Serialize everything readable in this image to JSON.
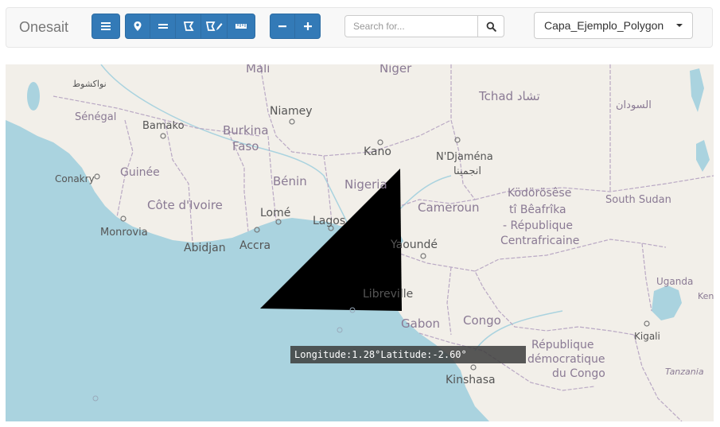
{
  "navbar": {
    "brand": "Onesait",
    "search": {
      "placeholder": "Search for...",
      "value": ""
    },
    "layer_select": {
      "selected": "Capa_Ejemplo_Polygon"
    }
  },
  "toolbar_icons": [
    "menu-icon",
    "map-marker-icon",
    "line-icon",
    "polygon-icon",
    "polygon-edit-icon",
    "ruler-icon",
    "zoom-out-icon",
    "zoom-in-icon",
    "search-icon"
  ],
  "colors": {
    "primary": "#337ab7",
    "ocean": "#aad3df",
    "land": "#f2efe9",
    "border": "#b9a8c4",
    "polygon": "#000000"
  },
  "map": {
    "country_labels": [
      {
        "text": "Mali",
        "type": "country"
      },
      {
        "text": "Niger",
        "type": "country"
      },
      {
        "text": "Tchad تشاد",
        "type": "country"
      },
      {
        "text": "السودان",
        "type": "country"
      },
      {
        "text": "Sénégal",
        "type": "country"
      },
      {
        "text": "Burkina",
        "type": "country"
      },
      {
        "text": "Faso",
        "type": "country"
      },
      {
        "text": "Guinée",
        "type": "country"
      },
      {
        "text": "Bénin",
        "type": "country"
      },
      {
        "text": "Nigeria",
        "type": "country"
      },
      {
        "text": "Côte d'Ivoire",
        "type": "country"
      },
      {
        "text": "Cameroun",
        "type": "country"
      },
      {
        "text": "Ködörösêse",
        "type": "country"
      },
      {
        "text": "tî Bêafrîka",
        "type": "country"
      },
      {
        "text": "- République",
        "type": "country"
      },
      {
        "text": "Centrafricaine",
        "type": "country"
      },
      {
        "text": "South Sudan",
        "type": "country"
      },
      {
        "text": "Uganda",
        "type": "country"
      },
      {
        "text": "Gabon",
        "type": "country"
      },
      {
        "text": "Congo",
        "type": "country"
      },
      {
        "text": "République",
        "type": "country"
      },
      {
        "text": "démocratique",
        "type": "country"
      },
      {
        "text": "du Congo",
        "type": "country"
      },
      {
        "text": "Tanzania",
        "type": "country"
      },
      {
        "text": "Kenya",
        "type": "country"
      },
      {
        "text": "نواكشوط",
        "type": "city"
      },
      {
        "text": "Bamako",
        "type": "city"
      },
      {
        "text": "Niamey",
        "type": "city"
      },
      {
        "text": "Kano",
        "type": "city"
      },
      {
        "text": "N'Djaména",
        "type": "city"
      },
      {
        "text": "انجمينا",
        "type": "city"
      },
      {
        "text": "Conakry",
        "type": "city"
      },
      {
        "text": "Lomé",
        "type": "city"
      },
      {
        "text": "Lagos",
        "type": "city"
      },
      {
        "text": "Monrovia",
        "type": "city"
      },
      {
        "text": "Accra",
        "type": "city"
      },
      {
        "text": "Abidjan",
        "type": "city"
      },
      {
        "text": "Yaoundé",
        "type": "city"
      },
      {
        "text": "Libreville",
        "type": "city"
      },
      {
        "text": "Kigali",
        "type": "city"
      },
      {
        "text": "Kinshasa",
        "type": "city"
      }
    ],
    "cursor": {
      "longitude_label": "Longitude:",
      "longitude_value": "1.28°",
      "latitude_label": "Latitude:",
      "latitude_value": "-2.60°"
    }
  }
}
